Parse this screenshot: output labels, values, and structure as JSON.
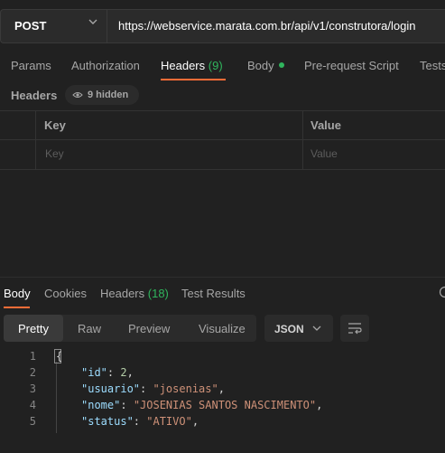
{
  "request": {
    "method": "POST",
    "url": "https://webservice.marata.com.br/api/v1/construtora/login"
  },
  "request_tabs": {
    "params": "Params",
    "authorization": "Authorization",
    "headers": "Headers",
    "headers_count": "(9)",
    "body": "Body",
    "prerequest": "Pre-request Script",
    "tests": "Tests"
  },
  "headers_section": {
    "title": "Headers",
    "hidden": "9 hidden",
    "col_key": "Key",
    "col_value": "Value",
    "key_placeholder": "Key",
    "value_placeholder": "Value"
  },
  "response_tabs": {
    "body": "Body",
    "cookies": "Cookies",
    "headers": "Headers",
    "headers_count": "(18)",
    "test_results": "Test Results"
  },
  "view_modes": {
    "pretty": "Pretty",
    "raw": "Raw",
    "preview": "Preview",
    "visualize": "Visualize",
    "format": "JSON"
  },
  "code_lines": [
    {
      "num": "1",
      "open": "{"
    },
    {
      "num": "2",
      "key": "\"id\"",
      "value": "2",
      "value_type": "number"
    },
    {
      "num": "3",
      "key": "\"usuario\"",
      "value": "\"josenias\"",
      "value_type": "string"
    },
    {
      "num": "4",
      "key": "\"nome\"",
      "value": "\"JOSENIAS SANTOS NASCIMENTO\"",
      "value_type": "string"
    },
    {
      "num": "5",
      "key": "\"status\"",
      "value": "\"ATIVO\"",
      "value_type": "string"
    }
  ],
  "colors": {
    "accent": "#ff6c37",
    "count_green": "#30b55d",
    "background": "#212121"
  }
}
